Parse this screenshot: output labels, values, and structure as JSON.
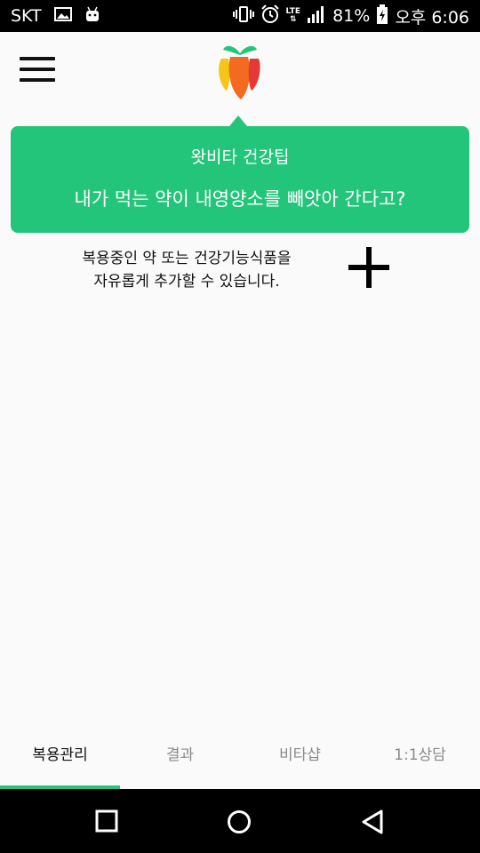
{
  "status_bar": {
    "carrier": "SKT",
    "lte": "LTE",
    "battery": "81%",
    "time": "오후 6:06",
    "icons": [
      "image-icon",
      "android-icon",
      "vibrate-icon",
      "alarm-icon",
      "lte-data-icon",
      "signal-icon",
      "battery-charging-icon"
    ]
  },
  "header": {
    "menu_icon": "hamburger-menu-icon",
    "logo_icon": "whatvita-logo"
  },
  "tip": {
    "title": "왓비타 건강팁",
    "body": "내가 먹는 약이 내영양소를 빼앗아 간다고?"
  },
  "add_hint": {
    "line1": "복용중인 약 또는 건강기능식품을",
    "line2": "자유롭게 추가할 수 있습니다.",
    "icon": "plus-icon"
  },
  "tabs": [
    {
      "label": "복용관리",
      "active": true
    },
    {
      "label": "결과",
      "active": false
    },
    {
      "label": "비타샵",
      "active": false
    },
    {
      "label": "1:1상담",
      "active": false
    }
  ],
  "colors": {
    "accent": "#23c57a",
    "background": "#fafafa",
    "statusbar": "#000000"
  },
  "nav": [
    "recent-apps-icon",
    "home-icon",
    "back-icon"
  ]
}
